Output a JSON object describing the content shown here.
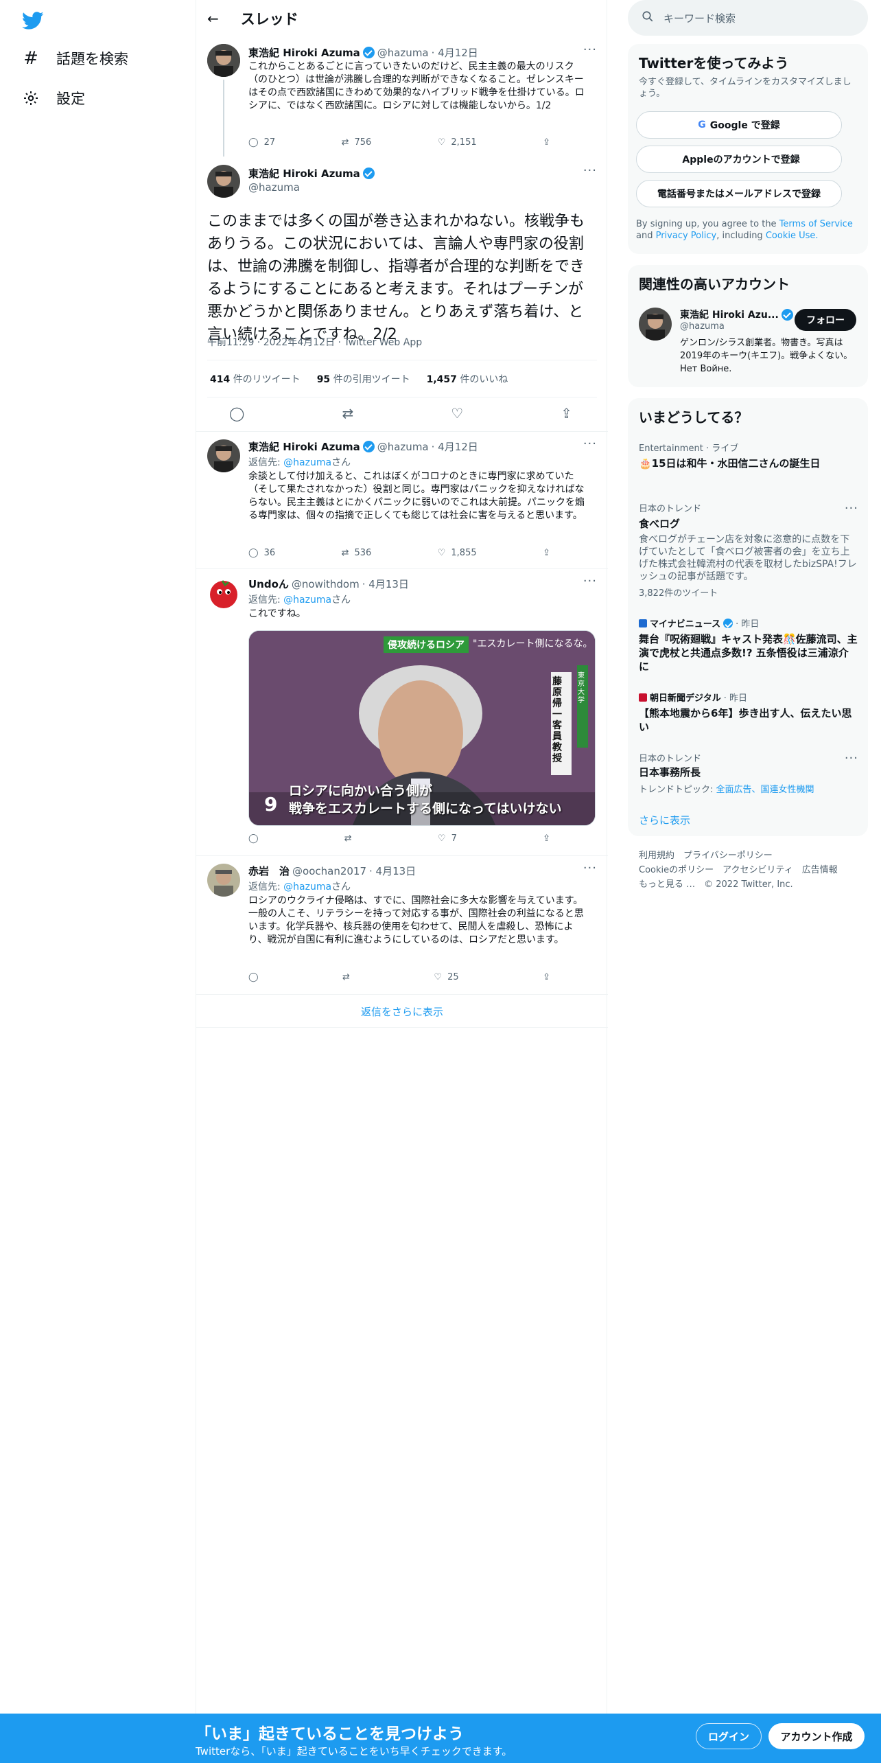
{
  "nav": {
    "explore": "話題を検索",
    "settings": "設定"
  },
  "header": {
    "title": "スレッド"
  },
  "tweet1": {
    "name": "東浩紀 Hiroki Azuma",
    "handle": "@hazuma",
    "date": "· 4月12日",
    "body": "これからことあるごとに言っていきたいのだけど、民主主義の最大のリスク（のひとつ）は世論が沸騰し合理的な判断ができなくなること。ゼレンスキーはその点で西欧諸国にきわめて効果的なハイブリッド戦争を仕掛けている。ロシアに、ではなく西欧諸国に。ロシアに対しては機能しないから。1/2",
    "replies": "27",
    "retweets": "756",
    "likes": "2,151"
  },
  "main_tweet": {
    "name": "東浩紀 Hiroki Azuma",
    "handle": "@hazuma",
    "body": "このままでは多くの国が巻き込まれかねない。核戦争もありうる。この状況においては、言論人や専門家の役割は、世論の沸騰を制御し、指導者が合理的な判断をできるようにすることにあると考えます。それはプーチンが悪かどうかと関係ありません。とりあえず落ち着け、と言い続けることですね。2/2",
    "meta": "午前11:29 · 2022年4月12日 · Twitter Web App",
    "rt_count": "414",
    "rt_label": "件のリツイート",
    "qt_count": "95",
    "qt_label": "件の引用ツイート",
    "like_count": "1,457",
    "like_label": "件のいいね"
  },
  "reply1": {
    "name": "東浩紀 Hiroki Azuma",
    "handle": "@hazuma",
    "date": "· 4月12日",
    "reply_prefix": "返信先:",
    "reply_to": "@hazuma",
    "reply_suffix": "さん",
    "body": "余談として付け加えると、これはぼくがコロナのときに専門家に求めていた（そして果たされなかった）役割と同じ。専門家はパニックを抑えなければならない。民主主義はとにかくパニックに弱いのでこれは大前提。パニックを煽る専門家は、個々の指摘で正しくても総じては社会に害を与えると思います。",
    "replies": "36",
    "retweets": "536",
    "likes": "1,855"
  },
  "reply2": {
    "name": "Undoん",
    "handle": "@nowithdom",
    "date": "· 4月13日",
    "reply_prefix": "返信先:",
    "reply_to": "@hazuma",
    "reply_suffix": "さん",
    "body": "これですね。",
    "likes": "7",
    "image": {
      "tag": "侵攻続けるロシア",
      "quote": "\"エスカレート側になるな。",
      "name_vertical": "藤原帰一 客員教授",
      "school": "東京大学",
      "caption1": "ロシアに向かい合う側が",
      "caption2": "戦争をエスカレートする側になってはいけない"
    }
  },
  "reply3": {
    "name": "赤岩　治",
    "handle": "@oochan2017",
    "date": "· 4月13日",
    "reply_prefix": "返信先:",
    "reply_to": "@hazuma",
    "reply_suffix": "さん",
    "body": "ロシアのウクライナ侵略は、すでに、国際社会に多大な影響を与えています。一般の人こそ、リテラシーを持って対応する事が、国際社会の利益になると思います。化学兵器や、核兵器の使用を匂わせて、民間人を虐殺し、恐怖により、戦況が自国に有利に進むようにしているのは、ロシアだと思います。",
    "likes": "25"
  },
  "show_more_replies": "返信をさらに表示",
  "search": {
    "placeholder": "キーワード検索"
  },
  "signup": {
    "title": "Twitterを使ってみよう",
    "subtitle": "今すぐ登録して、タイムラインをカスタマイズしましょう。",
    "google": "Google で登録",
    "apple": "Appleのアカウントで登録",
    "phone": "電話番号またはメールアドレスで登録",
    "terms_pre": "By signing up, you agree to the",
    "terms": "Terms of Service",
    "and": "and",
    "privacy": "Privacy Policy",
    "including": ", including",
    "cookie": "Cookie Use."
  },
  "related": {
    "title": "関連性の高いアカウント",
    "name": "東浩紀 Hiroki Azu...",
    "handle": "@hazuma",
    "follow": "フォロー",
    "bio": "ゲンロン/シラス創業者。物書き。写真は2019年のキーウ(キエフ)。戦争よくない。Нет Войне."
  },
  "trends": {
    "title": "いまどうしてる？",
    "items": [
      {
        "cat": "Entertainment · ライブ",
        "title": "🎂15日は和牛・水田信二さんの誕生日"
      },
      {
        "cat": "日本のトレンド",
        "title": "食べログ",
        "desc": "食べログがチェーン店を対象に恣意的に点数を下げていたとして「食べログ被害者の会」を立ち上げた株式会社韓流村の代表を取材したbizSPA!フレッシュの記事が話題です。",
        "count": "3,822件のツイート"
      },
      {
        "cat": "マイナビニュース",
        "cat2": "· 昨日",
        "title": "舞台『呪術廻戦』キャスト発表🎊佐藤流司、主演で虎杖と共通点多数!? 五条悟役は三浦涼介に"
      },
      {
        "cat": "朝日新聞デジタル",
        "cat2": "· 昨日",
        "title": "【熊本地震から6年】歩き出す人、伝えたい思い"
      },
      {
        "cat": "日本のトレンド",
        "title": "日本事務所長",
        "topic_label": "トレンドトピック:",
        "topic": "全面広告、国連女性機関"
      }
    ],
    "more": "さらに表示"
  },
  "footer": {
    "l1": "利用規約　プライバシーポリシー",
    "l2": "Cookieのポリシー　アクセシビリティ　広告情報",
    "l3": "もっと見る …　© 2022 Twitter, Inc."
  },
  "bottom": {
    "headline": "「いま」起きていることを見つけよう",
    "sub": "Twitterなら、「いま」起きていることをいち早くチェックできます。",
    "login": "ログイン",
    "signup": "アカウント作成"
  },
  "colors": {
    "accent": "#1d9bf0",
    "text": "#0f1419",
    "muted": "#536471"
  }
}
